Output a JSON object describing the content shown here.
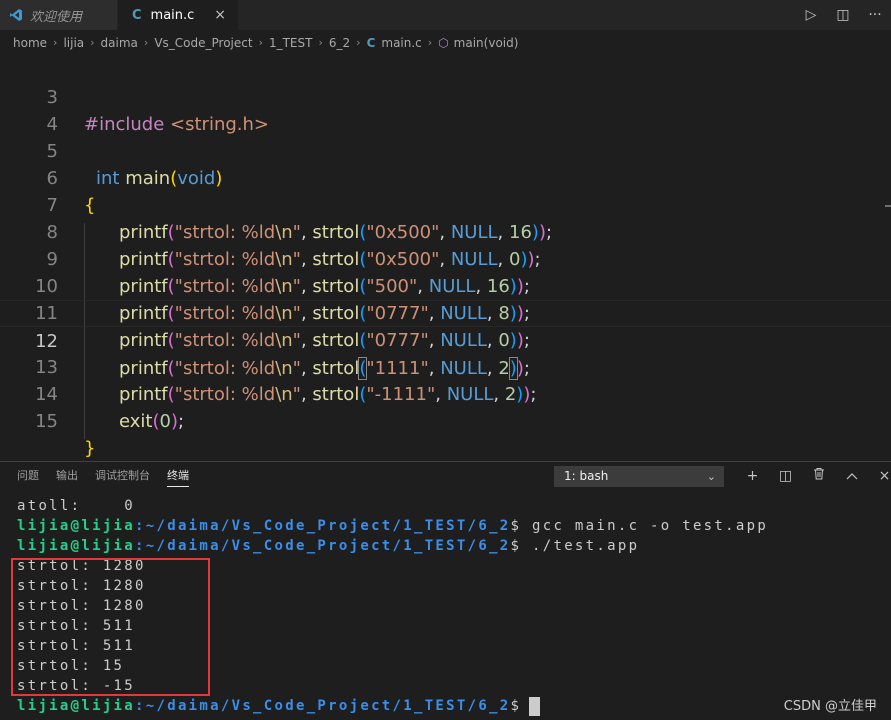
{
  "tabs": {
    "welcome_label": "欢迎使用",
    "main_label": "main.c",
    "c_icon_text": "C",
    "close_icon": "×"
  },
  "top_actions": {
    "run_icon": "▷",
    "split_icon": "◫",
    "more_icon": "···"
  },
  "breadcrumb": {
    "items": [
      "home",
      "lijia",
      "daima",
      "Vs_Code_Project",
      "1_TEST",
      "6_2"
    ],
    "file": "main.c",
    "symbol": "main(void)"
  },
  "editor": {
    "line_numbers": [
      "3",
      "4",
      "5",
      "6",
      "7",
      "8",
      "9",
      "10",
      "11",
      "12",
      "13",
      "14",
      "15"
    ],
    "include_kw": "#include",
    "include_file": "<string.h>",
    "int_kw": "int",
    "main_fn": "main",
    "void_kw": "void",
    "open_brace": "{",
    "close_brace": "}",
    "printf_fn": "printf",
    "fmt_prefix": "\"strtol: %ld",
    "fmt_escape": "\\n",
    "fmt_suffix": "\"",
    "strtol_fn": "strtol",
    "null_kw": "NULL",
    "exit_fn": "exit",
    "exit_arg": "0",
    "calls": [
      {
        "str": "\"0x500\"",
        "base": "16"
      },
      {
        "str": "\"0x500\"",
        "base": "0"
      },
      {
        "str": "\"500\"",
        "base": "16"
      },
      {
        "str": "\"0777\"",
        "base": "8"
      },
      {
        "str": "\"0777\"",
        "base": "0"
      },
      {
        "str": "\"1111\"",
        "base": "2"
      },
      {
        "str": "\"-1111\"",
        "base": "2"
      }
    ]
  },
  "panel": {
    "tabs": [
      "问题",
      "输出",
      "调试控制台",
      "终端"
    ],
    "active_tab": "终端",
    "terminal_select": "1: bash",
    "actions": {
      "add": "+",
      "split": "◫",
      "trash": "🗑",
      "maximize": "^",
      "close": "×"
    }
  },
  "terminal": {
    "atoll_line": "atoll:    0",
    "prompt_user": "lijia@lijia",
    "prompt_path": ":~/daima/Vs_Code_Project/1_TEST/6_2",
    "prompt_dollar": "$",
    "cmd1": " gcc main.c -o test.app",
    "cmd2": " ./test.app",
    "output": [
      "strtol: 1280",
      "strtol: 1280",
      "strtol: 1280",
      "strtol: 511",
      "strtol: 511",
      "strtol: 15",
      "strtol: -15"
    ]
  },
  "watermark": "CSDN @立佳甲",
  "colors": {
    "editor_bg": "#1e1e1e",
    "prompt_user": "#23d18b",
    "prompt_path": "#3b8eea",
    "highlight_box": "#e23a3a"
  }
}
